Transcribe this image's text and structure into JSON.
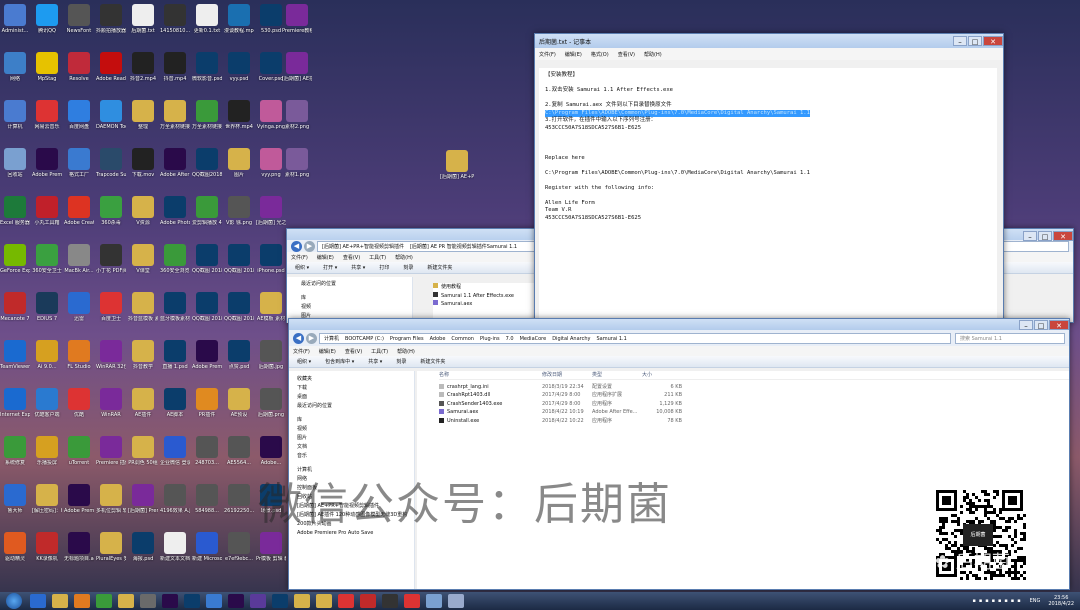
{
  "desktop_icons": [
    {
      "label": "Administ...",
      "color": "#4a7bd0"
    },
    {
      "label": "腾讯QQ",
      "color": "#1d9bf0"
    },
    {
      "label": "NewsFont",
      "color": "#555"
    },
    {
      "label": "抖颜拍播放器6.exe",
      "color": "#333"
    },
    {
      "label": "后期菌.txt",
      "color": "#eee"
    },
    {
      "label": "14150810...",
      "color": "#333"
    },
    {
      "label": "更新0.1.txt",
      "color": "#eee"
    },
    {
      "label": "漫谈教程.mp4",
      "color": "#1a6fb0"
    },
    {
      "label": "530.psd",
      "color": "#0b3d6b"
    },
    {
      "label": "Premiere教程 视频说...",
      "color": "#7a2a9a"
    },
    {
      "label": "网络",
      "color": "#3d7fc8"
    },
    {
      "label": "MpStag",
      "color": "#e6c200"
    },
    {
      "label": "Resolve",
      "color": "#c02a3a"
    },
    {
      "label": "Adobe Reader XI",
      "color": "#c40d0d"
    },
    {
      "label": "抖音2.mp4",
      "color": "#222"
    },
    {
      "label": "抖音.mp4",
      "color": "#222"
    },
    {
      "label": "微软影音.psd",
      "color": "#0b3d6b"
    },
    {
      "label": "vyy.psd",
      "color": "#0b3d6b"
    },
    {
      "label": "Cover.psd",
      "color": "#0b3d6b"
    },
    {
      "label": "[后期菌] AE插件 1...",
      "color": "#7a2a9a"
    },
    {
      "label": "计算机",
      "color": "#4a7bd0"
    },
    {
      "label": "网易云音乐",
      "color": "#d33"
    },
    {
      "label": "百度网盘",
      "color": "#2f7ee0"
    },
    {
      "label": "DAEMON Tools Lite",
      "color": "#2f8ee0"
    },
    {
      "label": "整理",
      "color": "#d6b24a"
    },
    {
      "label": "万圣素材链接.mp4_files",
      "color": "#d6b24a"
    },
    {
      "label": "万圣素材链接教程.html",
      "color": "#3a9a3a"
    },
    {
      "label": "世界杯.mp4",
      "color": "#222"
    },
    {
      "label": "Vyinga.png",
      "color": "#c05a9a"
    },
    {
      "label": "素材2.png",
      "color": "#7a5a9a"
    },
    {
      "label": "回收站",
      "color": "#7aa0d0"
    },
    {
      "label": "Adobe Premie...",
      "color": "#2a0a4a"
    },
    {
      "label": "格式工厂",
      "color": "#3a7ad0"
    },
    {
      "label": "Trapcode Suite 12.1...",
      "color": "#2a4a6a"
    },
    {
      "label": "下载.mov",
      "color": "#222"
    },
    {
      "label": "Adobe After Effects CC...",
      "color": "#2a0a4a"
    },
    {
      "label": "QQ截图20180420...",
      "color": "#0b3d6b"
    },
    {
      "label": "图片",
      "color": "#d6b24a"
    },
    {
      "label": "vyy.png",
      "color": "#c05a9a"
    },
    {
      "label": "素材1.png",
      "color": "#7a5a9a"
    },
    {
      "label": "Excel 服务器 客户端",
      "color": "#1d7a3a"
    },
    {
      "label": "小丸工具箱",
      "color": "#c0202a"
    },
    {
      "label": "Adobe Creati...",
      "color": "#d32"
    },
    {
      "label": "360杀毒",
      "color": "#3aa040"
    },
    {
      "label": "V资源",
      "color": "#d6b24a"
    },
    {
      "label": "Adobe Photosh...",
      "color": "#0b3d6b"
    },
    {
      "label": "爱剪辑播放 4.8.0.exe",
      "color": "#3a9a3a"
    },
    {
      "label": "V影 徐.png",
      "color": "#555"
    },
    {
      "label": "[后期菌] 光之旅...",
      "color": "#7a2a9a"
    },
    {
      "label": "",
      "color": "transparent"
    },
    {
      "label": "GeForce Experience",
      "color": "#76b900"
    },
    {
      "label": "360安全卫士",
      "color": "#3aa040"
    },
    {
      "label": "MacBk Air...",
      "color": "#888"
    },
    {
      "label": "小丁花 PDF阅读器",
      "color": "#333"
    },
    {
      "label": "V课堂",
      "color": "#d6b24a"
    },
    {
      "label": "360安全浏览器",
      "color": "#3a9a3a"
    },
    {
      "label": "QQ截图 20180420...",
      "color": "#0b3d6b"
    },
    {
      "label": "QQ截图 20180420...",
      "color": "#0b3d6b"
    },
    {
      "label": "iPhone.psd",
      "color": "#0b3d6b"
    },
    {
      "label": "",
      "color": "transparent"
    },
    {
      "label": "Mecanote 7",
      "color": "#c02a2a"
    },
    {
      "label": "EDIUS 7",
      "color": "#1a3a5a"
    },
    {
      "label": "迅雷",
      "color": "#2a6ad0"
    },
    {
      "label": "百度卫士",
      "color": "#d33"
    },
    {
      "label": "抖音蓝模板 素材",
      "color": "#d6b24a"
    },
    {
      "label": "蓝牙模板素材...",
      "color": "#0b3d6b"
    },
    {
      "label": "QQ截图 20180420...",
      "color": "#0b3d6b"
    },
    {
      "label": "QQ截图 20180420...",
      "color": "#0b3d6b"
    },
    {
      "label": "AE模板 素材",
      "color": "#d6b24a"
    },
    {
      "label": "",
      "color": "transparent"
    },
    {
      "label": "TeamViewer",
      "color": "#1a6ad0"
    },
    {
      "label": "Ai 9.0...",
      "color": "#d6a020"
    },
    {
      "label": "FL Studio",
      "color": "#e07a20"
    },
    {
      "label": "WinRAR 32位",
      "color": "#7a2a9a"
    },
    {
      "label": "抖音教学",
      "color": "#d6b24a"
    },
    {
      "label": "直播 1.psd",
      "color": "#0b3d6b"
    },
    {
      "label": "Adobe Premie...",
      "color": "#2a0a4a"
    },
    {
      "label": "点赞.psd",
      "color": "#0b3d6b"
    },
    {
      "label": "后期菌.jpg",
      "color": "#555"
    },
    {
      "label": "",
      "color": "transparent"
    },
    {
      "label": "Internet Explorer",
      "color": "#1a6ad0"
    },
    {
      "label": "优酷客户端",
      "color": "#2a7ad0"
    },
    {
      "label": "优酷",
      "color": "#d33"
    },
    {
      "label": "WinRAR",
      "color": "#7a2a9a"
    },
    {
      "label": "AE插件",
      "color": "#d6b24a"
    },
    {
      "label": "AE脚本",
      "color": "#0b3d6b"
    },
    {
      "label": "PR插件",
      "color": "#e08a20"
    },
    {
      "label": "AE预设",
      "color": "#d6b24a"
    },
    {
      "label": "后期菌.png",
      "color": "#555"
    },
    {
      "label": "",
      "color": "transparent"
    },
    {
      "label": "系统修复",
      "color": "#3a9a3a"
    },
    {
      "label": "乐播投屏",
      "color": "#d6a020"
    },
    {
      "label": "uTorrent",
      "color": "#3a9a3a"
    },
    {
      "label": "Premiere 插件",
      "color": "#7a2a9a"
    },
    {
      "label": "PR调色 50组",
      "color": "#d6b24a"
    },
    {
      "label": "企业微信 登录.docx",
      "color": "#2a5ad0"
    },
    {
      "label": "248703...",
      "color": "#555"
    },
    {
      "label": "AE5564...",
      "color": "#555"
    },
    {
      "label": "Adobe...",
      "color": "#2a0a4a"
    },
    {
      "label": "",
      "color": "transparent"
    },
    {
      "label": "鲁大师",
      "color": "#2a6ad0"
    },
    {
      "label": "[解压密码]：hcus...",
      "color": "#d6b24a"
    },
    {
      "label": "Adobe Premie...",
      "color": "#2a0a4a"
    },
    {
      "label": "多机位剪辑 软件Plural...",
      "color": "#d6b24a"
    },
    {
      "label": "[后期菌] Premiere...",
      "color": "#7a2a9a"
    },
    {
      "label": "4196效果 A.jpg",
      "color": "#555"
    },
    {
      "label": "584988...",
      "color": "#555"
    },
    {
      "label": "26192250...",
      "color": "#555"
    },
    {
      "label": "场景.psd",
      "color": "#0b3d6b"
    },
    {
      "label": "",
      "color": "transparent"
    },
    {
      "label": "驱动精灵",
      "color": "#e05a20"
    },
    {
      "label": "KK录像机",
      "color": "#c02a2a"
    },
    {
      "label": "无标题项目.aep",
      "color": "#2a0a4a"
    },
    {
      "label": "PluralEyes 安装教程",
      "color": "#d6b24a"
    },
    {
      "label": "海报.psd",
      "color": "#0b3d6b"
    },
    {
      "label": "新建文本文档.txt",
      "color": "#eee"
    },
    {
      "label": "新建 Microsof...",
      "color": "#2a5ad0"
    },
    {
      "label": "e7ef9ebc...",
      "color": "#555"
    },
    {
      "label": "Pr模板 剪辑 教程项目",
      "color": "#7a2a9a"
    },
    {
      "label": "",
      "color": "transparent"
    }
  ],
  "folder_on_desktop": {
    "label": "[后期菌] AE+PR+..."
  },
  "notepad": {
    "title": "后期菌.txt - 记事本",
    "menu": [
      "文件(F)",
      "编辑(E)",
      "格式(O)",
      "查看(V)",
      "帮助(H)"
    ],
    "lines": [
      "【安装教程】",
      "",
      "1.双击安装 Samurai 1.1 After Effects.exe",
      "",
      "2.复制 Samurai.aex 文件到以下目录替换原文件",
      "C:\\Program Files\\ADOBE\\Common\\Plug-ins\\7.0\\MediaCore\\Digital Anarchy\\Samurai 1.1",
      "3.打开软件，在插件中输入以下序列号注册：",
      "453CCC50A7S18SDCA527S6B1-E625",
      "",
      "",
      "",
      "Replace here",
      "",
      "C:\\Program Files\\ADOBE\\Common\\Plug-ins\\7.0\\MediaCore\\Digital Anarchy\\Samurai 1.1",
      "",
      "Register with the following info:",
      "",
      "Allen Life Form",
      "Team V.R",
      "453CCC50A7S18SDCA527S6B1-E625"
    ],
    "highlight_index": 5
  },
  "explorer_back": {
    "path": [
      "[后期菌] AE+PR+智能视频剪辑插件",
      "[后期菌] AE PR 智能视频剪辑插件Samurai 1.1"
    ],
    "menu": [
      "文件(F)",
      "编辑(E)",
      "查看(V)",
      "工具(T)",
      "帮助(H)"
    ],
    "toolbar": [
      "组织 ▾",
      "打开 ▾",
      "共享 ▾",
      "打印",
      "刻录",
      "新建文件夹"
    ],
    "nav": [
      "最近访问的位置",
      "",
      "库",
      "视频",
      "图片"
    ],
    "files": [
      "使用教程",
      "Samurai 1.1 After Effects.exe",
      "Samurai.aex"
    ]
  },
  "explorer_front": {
    "path": [
      "计算机",
      "BOOTCAMP (C:)",
      "Program Files",
      "Adobe",
      "Common",
      "Plug-ins",
      "7.0",
      "MediaCore",
      "Digital Anarchy",
      "Samurai 1.1"
    ],
    "search": "搜索 Samurai 1.1",
    "menu": [
      "文件(F)",
      "编辑(E)",
      "查看(V)",
      "工具(T)",
      "帮助(H)"
    ],
    "toolbar": [
      "组织 ▾",
      "包含到库中 ▾",
      "共享 ▾",
      "刻录",
      "新建文件夹"
    ],
    "nav": [
      "收藏夹",
      "下载",
      "桌面",
      "最近访问的位置",
      "",
      "库",
      "视频",
      "图片",
      "文档",
      "音乐",
      "",
      "计算机",
      "网络",
      "控制面板",
      "回收站",
      "[后期菌] AE+PR+智能视频剪辑插件",
      "[后期菌] AE插件 120种动感图像模型无缝3D重构",
      "200款片头动画",
      "Adobe Premiere Pro Auto Save"
    ],
    "headers": {
      "name": "名称",
      "date": "修改日期",
      "type": "类型",
      "size": "大小"
    },
    "files": [
      {
        "name": "crashrpt_lang.ini",
        "date": "2018/3/19 22:34",
        "type": "配置设置",
        "size": "6 KB",
        "color": "#bbb"
      },
      {
        "name": "CrashRpt1403.dll",
        "date": "2017/4/29 8:00",
        "type": "应用程序扩展",
        "size": "211 KB",
        "color": "#bbb"
      },
      {
        "name": "CrashSender1403.exe",
        "date": "2017/4/29 8:00",
        "type": "应用程序",
        "size": "1,129 KB",
        "color": "#555"
      },
      {
        "name": "Samurai.aex",
        "date": "2018/4/22 10:19",
        "type": "Adobe After Effe...",
        "size": "10,008 KB",
        "color": "#7a6ad0"
      },
      {
        "name": "Uninstall.exe",
        "date": "2018/4/22 10:22",
        "type": "应用程序",
        "size": "78 KB",
        "color": "#222"
      }
    ]
  },
  "watermark": "微信公众号：后期菌",
  "qr_logo": "后期菌",
  "qr_caption": "后期菌",
  "tray": {
    "lang": "ENG",
    "time": "23:56",
    "date": "2018/4/22"
  }
}
